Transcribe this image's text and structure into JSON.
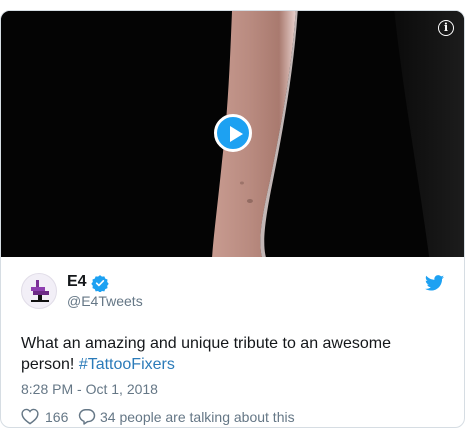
{
  "media": {
    "type": "video",
    "play_icon": "play-icon",
    "info_icon": "info-icon",
    "info_symbol": "i"
  },
  "author": {
    "display_name": "E4",
    "screen_name": "@E4Tweets",
    "verified": true
  },
  "tweet": {
    "text_before_hashtag": "What an amazing and unique tribute to an awesome person! ",
    "hashtag": "#TattooFixers",
    "timestamp": "8:28 PM - Oct 1, 2018"
  },
  "actions": {
    "like_count": "166",
    "conversation_text": "34 people are talking about this"
  },
  "colors": {
    "accent": "#1da1f2",
    "hashtag": "#2b7bb9",
    "secondary_text": "#657786",
    "border": "#d6dde3"
  }
}
